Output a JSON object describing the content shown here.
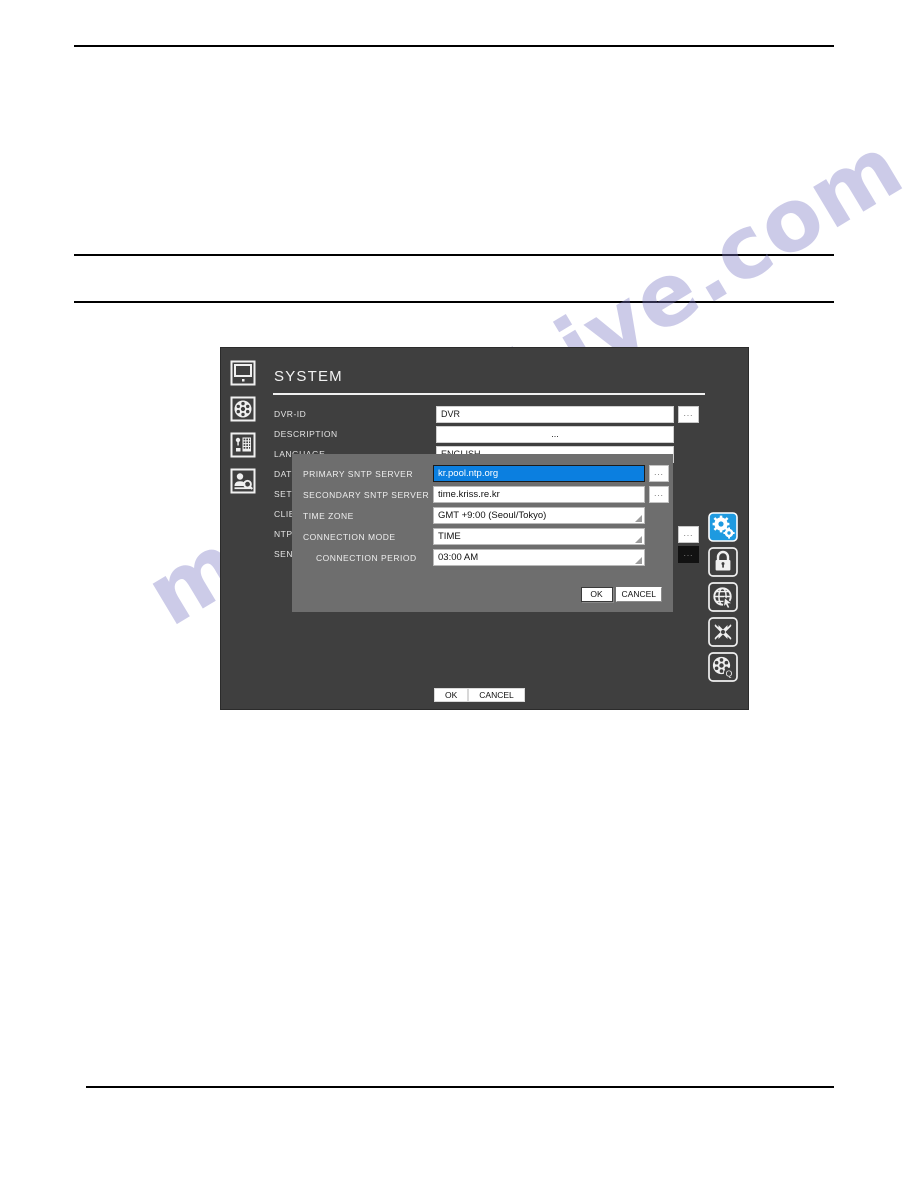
{
  "page": {
    "watermark": "manualshive.com"
  },
  "dvr": {
    "panel_title": "SYSTEM",
    "left_rail": [
      {
        "icon": "monitor-icon",
        "name": "display-settings"
      },
      {
        "icon": "film-reel-icon",
        "name": "recording-settings"
      },
      {
        "icon": "keypad-icon",
        "name": "device-settings"
      },
      {
        "icon": "person-search-icon",
        "name": "search-settings"
      }
    ],
    "right_rail": [
      {
        "icon": "gears-icon",
        "name": "system-settings",
        "active": true,
        "color": "#1e9ae0"
      },
      {
        "icon": "lock-icon",
        "name": "security-settings",
        "active": false
      },
      {
        "icon": "globe-cursor-icon",
        "name": "network-settings",
        "active": false
      },
      {
        "icon": "tools-icon",
        "name": "maintenance-settings",
        "active": false
      },
      {
        "icon": "film-reel-search-icon",
        "name": "backup-settings",
        "active": false
      }
    ],
    "background_form": [
      {
        "label": "DVR-ID",
        "value": "DVR",
        "type": "text",
        "dots": "...",
        "dots_style": "light"
      },
      {
        "label": "DESCRIPTION",
        "value": "...",
        "type": "center",
        "dots": ""
      },
      {
        "label": "LANGUAGE",
        "value": "ENGLISH",
        "type": "dropdown",
        "dots": ""
      },
      {
        "label": "DATE",
        "value": "",
        "type": "text",
        "dots": ""
      },
      {
        "label": "SET D",
        "value": "",
        "type": "text",
        "dots": ""
      },
      {
        "label": "CLIEN",
        "value": "",
        "type": "text",
        "dots": ""
      },
      {
        "label": "NTP",
        "value": "",
        "type": "text",
        "dots": "...",
        "dots_style": "light"
      },
      {
        "label": "SEND",
        "value": "",
        "type": "text",
        "dots": "...",
        "dots_style": "dark"
      }
    ],
    "dialog": {
      "rows": [
        {
          "label": "PRIMARY SNTP SERVER",
          "value": "kr.pool.ntp.org",
          "type": "text",
          "selected": true,
          "dots": "...",
          "indent": false
        },
        {
          "label": "SECONDARY SNTP SERVER",
          "value": "time.kriss.re.kr",
          "type": "text",
          "selected": false,
          "dots": "...",
          "indent": false
        },
        {
          "label": "TIME ZONE",
          "value": "GMT +9:00 (Seoul/Tokyo)",
          "type": "dropdown",
          "selected": false,
          "dots": "",
          "indent": false
        },
        {
          "label": "CONNECTION MODE",
          "value": "TIME",
          "type": "dropdown",
          "selected": false,
          "dots": "",
          "indent": false
        },
        {
          "label": "CONNECTION PERIOD",
          "value": "03:00 AM",
          "type": "dropdown",
          "selected": false,
          "dots": "",
          "indent": true
        }
      ],
      "ok_label": "OK",
      "cancel_label": "CANCEL"
    },
    "bottom": {
      "ok_label": "OK",
      "cancel_label": "CANCEL"
    }
  }
}
